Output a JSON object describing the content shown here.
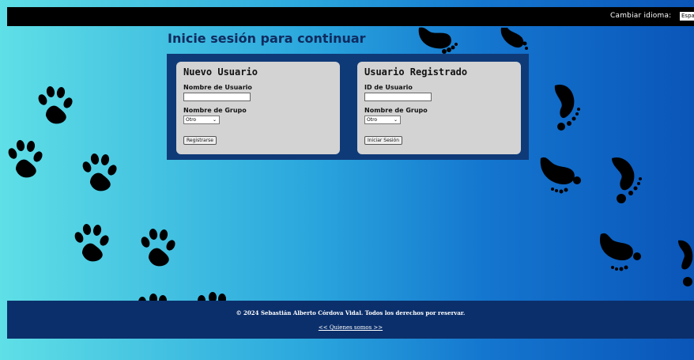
{
  "header": {
    "language_label": "Cambiar idioma:",
    "language_selected": "Español"
  },
  "page_title": "Inicie sesión para continuar",
  "new_user": {
    "title": "Nuevo Usuario",
    "username_label": "Nombre de Usuario",
    "username_value": "",
    "group_label": "Nombre de Grupo",
    "group_selected": "Otro",
    "register_button": "Registrarse"
  },
  "registered_user": {
    "title": "Usuario Registrado",
    "userid_label": "ID de Usuario",
    "userid_value": "",
    "group_label": "Nombre de Grupo",
    "group_selected": "Otro",
    "login_button": "Iniciar Sesión"
  },
  "footer": {
    "copyright": "© 2024 Sebastián Alberto Córdova Vidal. Todos los derechos por reservar.",
    "about_link": "<< Quienes somos >>"
  },
  "colors": {
    "topbar": "#000000",
    "panel": "#0f3a78",
    "card": "#d3d3d3",
    "footer": "#0b2f6b",
    "title": "#0f2a5e"
  }
}
